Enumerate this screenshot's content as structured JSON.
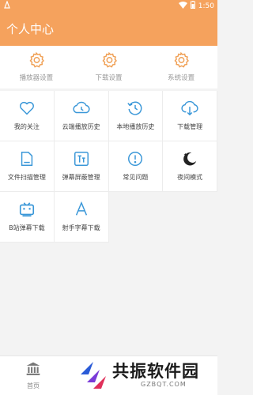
{
  "status_bar": {
    "time": "1:50"
  },
  "header": {
    "title": "个人中心"
  },
  "settings": [
    {
      "label": "播放器设置",
      "icon": "gear-icon"
    },
    {
      "label": "下载设置",
      "icon": "gear-icon"
    },
    {
      "label": "系统设置",
      "icon": "gear-icon"
    }
  ],
  "grid": [
    {
      "label": "我的关注",
      "icon": "heart-icon"
    },
    {
      "label": "云端播放历史",
      "icon": "cloud-clock-icon"
    },
    {
      "label": "本地播放历史",
      "icon": "history-clock-icon"
    },
    {
      "label": "下载管理",
      "icon": "cloud-download-icon"
    },
    {
      "label": "文件扫描管理",
      "icon": "file-icon"
    },
    {
      "label": "弹幕屏蔽管理",
      "icon": "text-block-icon"
    },
    {
      "label": "常见问题",
      "icon": "info-icon"
    },
    {
      "label": "夜间模式",
      "icon": "moon-icon"
    },
    {
      "label": "B站弹幕下载",
      "icon": "tv-icon"
    },
    {
      "label": "射手字幕下载",
      "icon": "letter-a-icon"
    }
  ],
  "bottom_nav": {
    "home_label": "首页"
  },
  "watermark": {
    "text": "共振软件园",
    "url": "GZBQT.COM"
  },
  "colors": {
    "accent": "#f5a25d",
    "icon_blue": "#3a97d8",
    "icon_orange": "#f0a055"
  }
}
